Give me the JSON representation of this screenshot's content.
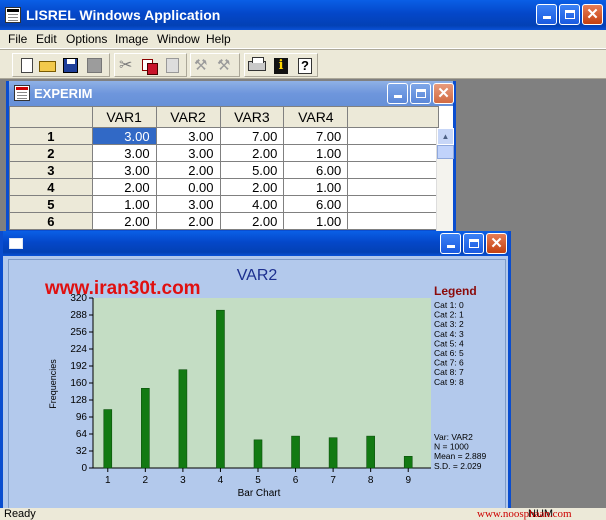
{
  "app": {
    "title": "LISREL Windows Application",
    "icon": "app-icon"
  },
  "menu": [
    "File",
    "Edit",
    "Options",
    "Image",
    "Window",
    "Help"
  ],
  "toolbar": {
    "buttons": [
      "new-icon",
      "open-icon",
      "save-icon",
      "disabled-icon",
      "cut-icon",
      "copy-icon",
      "paste-icon",
      "run-icon",
      "run-alt-icon",
      "print-icon",
      "info-icon",
      "help-icon"
    ]
  },
  "experim": {
    "title": "EXPERIM",
    "columns": [
      "VAR1",
      "VAR2",
      "VAR3",
      "VAR4"
    ],
    "rows": [
      {
        "id": "1",
        "values": [
          "3.00",
          "3.00",
          "7.00",
          "7.00"
        ]
      },
      {
        "id": "2",
        "values": [
          "3.00",
          "3.00",
          "2.00",
          "1.00"
        ]
      },
      {
        "id": "3",
        "values": [
          "3.00",
          "2.00",
          "5.00",
          "6.00"
        ]
      },
      {
        "id": "4",
        "values": [
          "2.00",
          "0.00",
          "2.00",
          "1.00"
        ]
      },
      {
        "id": "5",
        "values": [
          "1.00",
          "3.00",
          "4.00",
          "6.00"
        ]
      },
      {
        "id": "6",
        "values": [
          "2.00",
          "2.00",
          "2.00",
          "1.00"
        ]
      }
    ],
    "selected_cell": "1-VAR1"
  },
  "chart_window": {
    "watermark": "www.iran30t.com",
    "legend_title": "Legend",
    "legend_items": [
      "Cat 1: 0",
      "Cat 2: 1",
      "Cat 3: 2",
      "Cat 4: 3",
      "Cat 5: 4",
      "Cat 6: 5",
      "Cat 7: 6",
      "Cat 8: 7",
      "Cat 9: 8"
    ],
    "stats": [
      "Var: VAR2",
      "N = 1000",
      "Mean = 2.889",
      "S.D. = 2.029"
    ]
  },
  "chart_data": {
    "type": "bar",
    "title": "VAR2",
    "xlabel": "Bar Chart",
    "ylabel": "Frequencies",
    "categories": [
      "1",
      "2",
      "3",
      "4",
      "5",
      "6",
      "7",
      "8",
      "9"
    ],
    "values": [
      110,
      150,
      185,
      297,
      53,
      60,
      57,
      60,
      22
    ],
    "ylim": [
      0,
      320
    ],
    "yticks": [
      0,
      32,
      64,
      96,
      128,
      160,
      192,
      224,
      256,
      288,
      320
    ],
    "colors": {
      "bar": "#127a12",
      "plot_bg": "#c4ddc4",
      "title": "#1c2f8f",
      "legend_title": "#8b0a0a",
      "watermark": "#e01010"
    }
  },
  "status": {
    "left": "Ready",
    "right": "NUM",
    "watermark": "www.noosphaan.com"
  }
}
